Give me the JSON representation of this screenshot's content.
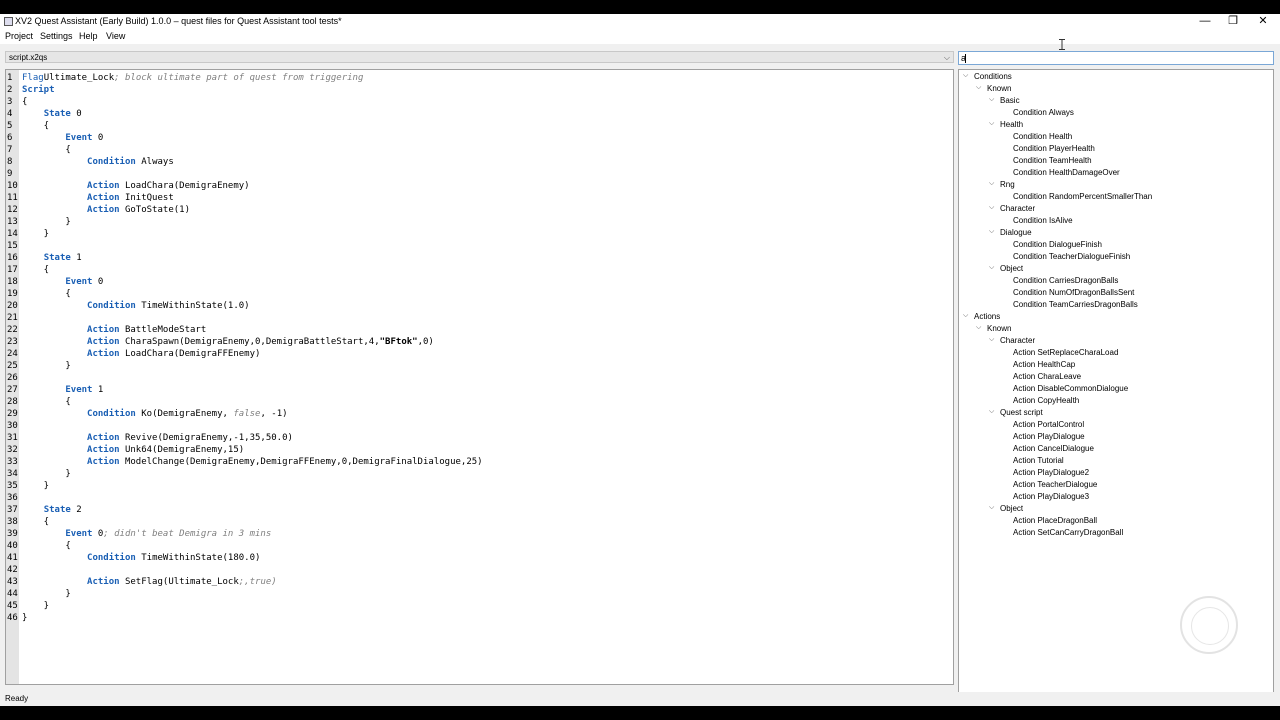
{
  "window": {
    "title": "XV2 Quest Assistant (Early Build) 1.0.0 – quest files for Quest Assistant tool tests*",
    "min_glyph": "—",
    "max_glyph": "❐",
    "close_glyph": "✕",
    "app_icon": "app-window-icon"
  },
  "menu": [
    "Project",
    "Settings",
    "Help",
    "View"
  ],
  "file_combo": {
    "value": "script.x2qs",
    "chevron": "⌵"
  },
  "editor": {
    "lines": [
      [
        [
          "kw2",
          "Flag"
        ],
        [
          "",
          "Ultimate_Lock"
        ],
        [
          "cm",
          "; block ultimate part of quest from triggering"
        ]
      ],
      [
        [
          "kw",
          "Script"
        ]
      ],
      [
        [
          "",
          "{"
        ]
      ],
      [
        [
          "",
          "    "
        ],
        [
          "kw",
          "State"
        ],
        [
          "",
          " 0"
        ]
      ],
      [
        [
          "",
          "    {"
        ]
      ],
      [
        [
          "",
          "        "
        ],
        [
          "kw",
          "Event"
        ],
        [
          "",
          " 0"
        ]
      ],
      [
        [
          "",
          "        {"
        ]
      ],
      [
        [
          "",
          "            "
        ],
        [
          "kw",
          "Condition"
        ],
        [
          "",
          " Always"
        ]
      ],
      [
        [
          "",
          ""
        ]
      ],
      [
        [
          "",
          "            "
        ],
        [
          "kw",
          "Action"
        ],
        [
          "",
          " LoadChara(DemigraEnemy)"
        ]
      ],
      [
        [
          "",
          "            "
        ],
        [
          "kw",
          "Action"
        ],
        [
          "",
          " InitQuest"
        ]
      ],
      [
        [
          "",
          "            "
        ],
        [
          "kw",
          "Action"
        ],
        [
          "",
          " GoToState(1)"
        ]
      ],
      [
        [
          "",
          "        }"
        ]
      ],
      [
        [
          "",
          "    }"
        ]
      ],
      [
        [
          "",
          ""
        ]
      ],
      [
        [
          "",
          "    "
        ],
        [
          "kw",
          "State"
        ],
        [
          "",
          " 1"
        ]
      ],
      [
        [
          "",
          "    {"
        ]
      ],
      [
        [
          "",
          "        "
        ],
        [
          "kw",
          "Event"
        ],
        [
          "",
          " 0"
        ]
      ],
      [
        [
          "",
          "        {"
        ]
      ],
      [
        [
          "",
          "            "
        ],
        [
          "kw",
          "Condition"
        ],
        [
          "",
          " TimeWithinState(1.0)"
        ]
      ],
      [
        [
          "",
          ""
        ]
      ],
      [
        [
          "",
          "            "
        ],
        [
          "kw",
          "Action"
        ],
        [
          "",
          " BattleModeStart"
        ]
      ],
      [
        [
          "",
          "            "
        ],
        [
          "kw",
          "Action"
        ],
        [
          "",
          " CharaSpawn(DemigraEnemy,0,DemigraBattleStart,4,"
        ],
        [
          "st",
          "\"BFtok\""
        ],
        [
          "",
          ",0)"
        ]
      ],
      [
        [
          "",
          "            "
        ],
        [
          "kw",
          "Action"
        ],
        [
          "",
          " LoadChara(DemigraFFEnemy)"
        ]
      ],
      [
        [
          "",
          "        }"
        ]
      ],
      [
        [
          "",
          ""
        ]
      ],
      [
        [
          "",
          "        "
        ],
        [
          "kw",
          "Event"
        ],
        [
          "",
          " 1"
        ]
      ],
      [
        [
          "",
          "        {"
        ]
      ],
      [
        [
          "",
          "            "
        ],
        [
          "kw",
          "Condition"
        ],
        [
          "",
          " Ko(DemigraEnemy, "
        ],
        [
          "bool",
          "false"
        ],
        [
          "",
          ", -1)"
        ]
      ],
      [
        [
          "",
          ""
        ]
      ],
      [
        [
          "",
          "            "
        ],
        [
          "kw",
          "Action"
        ],
        [
          "",
          " Revive(DemigraEnemy,-1,35,50.0)"
        ]
      ],
      [
        [
          "",
          "            "
        ],
        [
          "kw",
          "Action"
        ],
        [
          "",
          " Unk64(DemigraEnemy,15)"
        ]
      ],
      [
        [
          "",
          "            "
        ],
        [
          "kw",
          "Action"
        ],
        [
          "",
          " ModelChange(DemigraEnemy,DemigraFFEnemy,0,DemigraFinalDialogue,25)"
        ]
      ],
      [
        [
          "",
          "        }"
        ]
      ],
      [
        [
          "",
          "    }"
        ]
      ],
      [
        [
          "",
          ""
        ]
      ],
      [
        [
          "",
          "    "
        ],
        [
          "kw",
          "State"
        ],
        [
          "",
          " 2"
        ]
      ],
      [
        [
          "",
          "    {"
        ]
      ],
      [
        [
          "",
          "        "
        ],
        [
          "kw",
          "Event"
        ],
        [
          "",
          " 0"
        ],
        [
          "cm",
          "; didn't beat Demigra in 3 mins"
        ]
      ],
      [
        [
          "",
          "        {"
        ]
      ],
      [
        [
          "",
          "            "
        ],
        [
          "kw",
          "Condition"
        ],
        [
          "",
          " TimeWithinState(180.0)"
        ]
      ],
      [
        [
          "",
          ""
        ]
      ],
      [
        [
          "",
          "            "
        ],
        [
          "kw",
          "Action"
        ],
        [
          "",
          " SetFlag(Ultimate_Lock"
        ],
        [
          "cm",
          ";,true)"
        ]
      ],
      [
        [
          "",
          "        }"
        ]
      ],
      [
        [
          "",
          "    }"
        ]
      ],
      [
        [
          "",
          "}"
        ]
      ]
    ]
  },
  "search": {
    "value": "a"
  },
  "tree": [
    {
      "d": 0,
      "t": "Conditions",
      "x": true
    },
    {
      "d": 1,
      "t": "Known",
      "x": true
    },
    {
      "d": 2,
      "t": "Basic",
      "x": true
    },
    {
      "d": 3,
      "t": "Condition Always"
    },
    {
      "d": 2,
      "t": "Health",
      "x": true
    },
    {
      "d": 3,
      "t": "Condition Health"
    },
    {
      "d": 3,
      "t": "Condition PlayerHealth"
    },
    {
      "d": 3,
      "t": "Condition TeamHealth"
    },
    {
      "d": 3,
      "t": "Condition HealthDamageOver"
    },
    {
      "d": 2,
      "t": "Rng",
      "x": true
    },
    {
      "d": 3,
      "t": "Condition RandomPercentSmallerThan"
    },
    {
      "d": 2,
      "t": "Character",
      "x": true
    },
    {
      "d": 3,
      "t": "Condition IsAlive"
    },
    {
      "d": 2,
      "t": "Dialogue",
      "x": true
    },
    {
      "d": 3,
      "t": "Condition DialogueFinish"
    },
    {
      "d": 3,
      "t": "Condition TeacherDialogueFinish"
    },
    {
      "d": 2,
      "t": "Object",
      "x": true
    },
    {
      "d": 3,
      "t": "Condition CarriesDragonBalls"
    },
    {
      "d": 3,
      "t": "Condition NumOfDragonBallsSent"
    },
    {
      "d": 3,
      "t": "Condition TeamCarriesDragonBalls"
    },
    {
      "d": 0,
      "t": "Actions",
      "x": true
    },
    {
      "d": 1,
      "t": "Known",
      "x": true
    },
    {
      "d": 2,
      "t": "Character",
      "x": true
    },
    {
      "d": 3,
      "t": "Action SetReplaceCharaLoad"
    },
    {
      "d": 3,
      "t": "Action HealthCap"
    },
    {
      "d": 3,
      "t": "Action CharaLeave"
    },
    {
      "d": 3,
      "t": "Action DisableCommonDialogue"
    },
    {
      "d": 3,
      "t": "Action CopyHealth"
    },
    {
      "d": 2,
      "t": "Quest script",
      "x": true
    },
    {
      "d": 3,
      "t": "Action PortalControl"
    },
    {
      "d": 3,
      "t": "Action PlayDialogue"
    },
    {
      "d": 3,
      "t": "Action CancelDialogue"
    },
    {
      "d": 3,
      "t": "Action Tutorial"
    },
    {
      "d": 3,
      "t": "Action PlayDialogue2"
    },
    {
      "d": 3,
      "t": "Action TeacherDialogue"
    },
    {
      "d": 3,
      "t": "Action PlayDialogue3"
    },
    {
      "d": 2,
      "t": "Object",
      "x": true
    },
    {
      "d": 3,
      "t": "Action PlaceDragonBall"
    },
    {
      "d": 3,
      "t": "Action SetCanCarryDragonBall"
    }
  ],
  "status": "Ready",
  "colors": {
    "keyword": "#1a5fb4",
    "comment": "#808080",
    "gutter": "#e4e4e4",
    "search_border": "#7aa7d6"
  }
}
